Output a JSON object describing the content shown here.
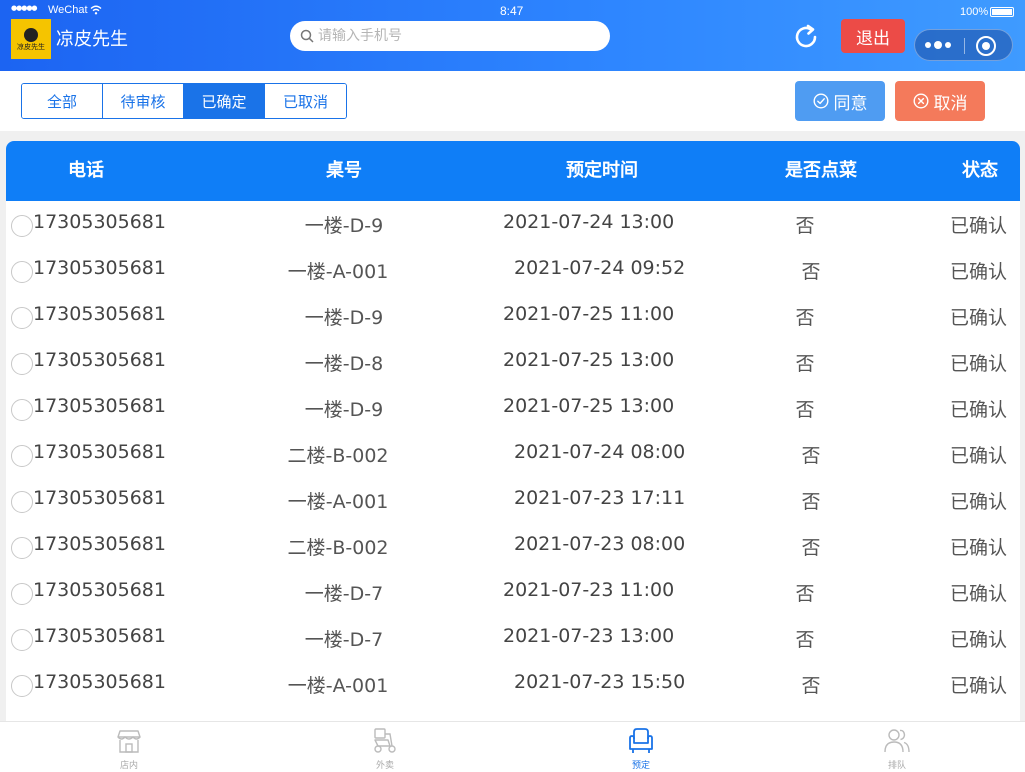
{
  "status_bar": {
    "signal": "●●●●●",
    "carrier": "WeChat",
    "time": "8:47",
    "battery": "100%"
  },
  "header": {
    "logo_text": "凉皮先生",
    "title": "凉皮先生",
    "search_placeholder": "请输入手机号",
    "logout_label": "退出"
  },
  "tabs": [
    {
      "label": "全部",
      "active": false
    },
    {
      "label": "待审核",
      "active": false
    },
    {
      "label": "已确定",
      "active": true
    },
    {
      "label": "已取消",
      "active": false
    }
  ],
  "actions": {
    "agree_label": "同意",
    "cancel_label": "取消"
  },
  "table": {
    "columns": [
      "电话",
      "桌号",
      "预定时间",
      "是否点菜",
      "状态"
    ],
    "rows": [
      {
        "phone": "17305305681",
        "table": "一楼-D-9",
        "time": "2021-07-24 13:00",
        "ordered": "否",
        "status": "已确认"
      },
      {
        "phone": "17305305681",
        "table": "一楼-A-001",
        "time": "2021-07-24 09:52",
        "ordered": "否",
        "status": "已确认"
      },
      {
        "phone": "17305305681",
        "table": "一楼-D-9",
        "time": "2021-07-25 11:00",
        "ordered": "否",
        "status": "已确认"
      },
      {
        "phone": "17305305681",
        "table": "一楼-D-8",
        "time": "2021-07-25 13:00",
        "ordered": "否",
        "status": "已确认"
      },
      {
        "phone": "17305305681",
        "table": "一楼-D-9",
        "time": "2021-07-25 13:00",
        "ordered": "否",
        "status": "已确认"
      },
      {
        "phone": "17305305681",
        "table": "二楼-B-002",
        "time": "2021-07-24 08:00",
        "ordered": "否",
        "status": "已确认"
      },
      {
        "phone": "17305305681",
        "table": "一楼-A-001",
        "time": "2021-07-23 17:11",
        "ordered": "否",
        "status": "已确认"
      },
      {
        "phone": "17305305681",
        "table": "二楼-B-002",
        "time": "2021-07-23 08:00",
        "ordered": "否",
        "status": "已确认"
      },
      {
        "phone": "17305305681",
        "table": "一楼-D-7",
        "time": "2021-07-23 11:00",
        "ordered": "否",
        "status": "已确认"
      },
      {
        "phone": "17305305681",
        "table": "一楼-D-7",
        "time": "2021-07-23 13:00",
        "ordered": "否",
        "status": "已确认"
      },
      {
        "phone": "17305305681",
        "table": "一楼-A-001",
        "time": "2021-07-23 15:50",
        "ordered": "否",
        "status": "已确认"
      }
    ]
  },
  "bottom_nav": [
    {
      "label": "店内",
      "icon": "store-icon",
      "active": false
    },
    {
      "label": "外卖",
      "icon": "scooter-icon",
      "active": false
    },
    {
      "label": "预定",
      "icon": "sofa-icon",
      "active": true
    },
    {
      "label": "排队",
      "icon": "users-icon",
      "active": false
    }
  ],
  "colors": {
    "primary": "#1a73e8",
    "header_gradient_start": "#1c64f2",
    "table_header": "#0f7ef7",
    "logout": "#ec4b47",
    "agree": "#4f9cf2",
    "cancel": "#f47a5b"
  }
}
